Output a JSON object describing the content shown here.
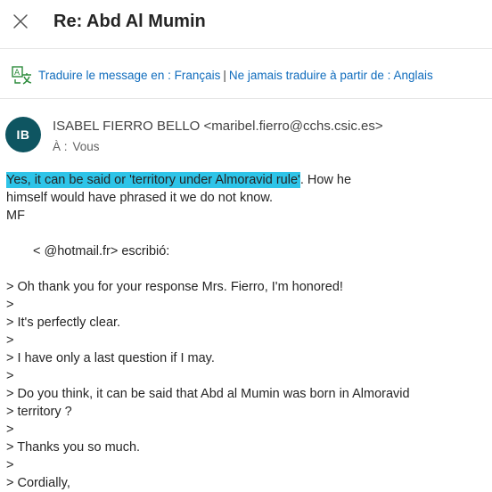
{
  "header": {
    "subject": "Re: Abd Al Mumin"
  },
  "translate": {
    "prompt": "Traduire le message en : Français",
    "separator": "|",
    "never": "Ne jamais traduire à partir de : Anglais"
  },
  "message": {
    "avatar_initials": "IB",
    "avatar_color": "#0e5561",
    "sender": "ISABEL FIERRO BELLO <maribel.fierro@cchs.csic.es>",
    "to_label": "À :",
    "to_value": "Vous",
    "highlight_color": "#2ec4e8",
    "reply": {
      "highlighted": "Yes, it can be said or 'territory under Almoravid rule'",
      "rest_line1": ". How he",
      "line2": "himself would have phrased it we do not know.",
      "signature": "MF"
    },
    "attribution": "<          @hotmail.fr> escribió:",
    "quoted_lines": [
      "> Oh thank you for your response Mrs. Fierro, I'm honored!",
      ">",
      "> It's perfectly clear.",
      ">",
      "> I have only a last question if I may.",
      ">",
      "> Do you think, it can be said that Abd al Mumin was born in Almoravid",
      "> territory ?",
      ">",
      "> Thanks you so much.",
      ">",
      "> Cordially,"
    ]
  }
}
